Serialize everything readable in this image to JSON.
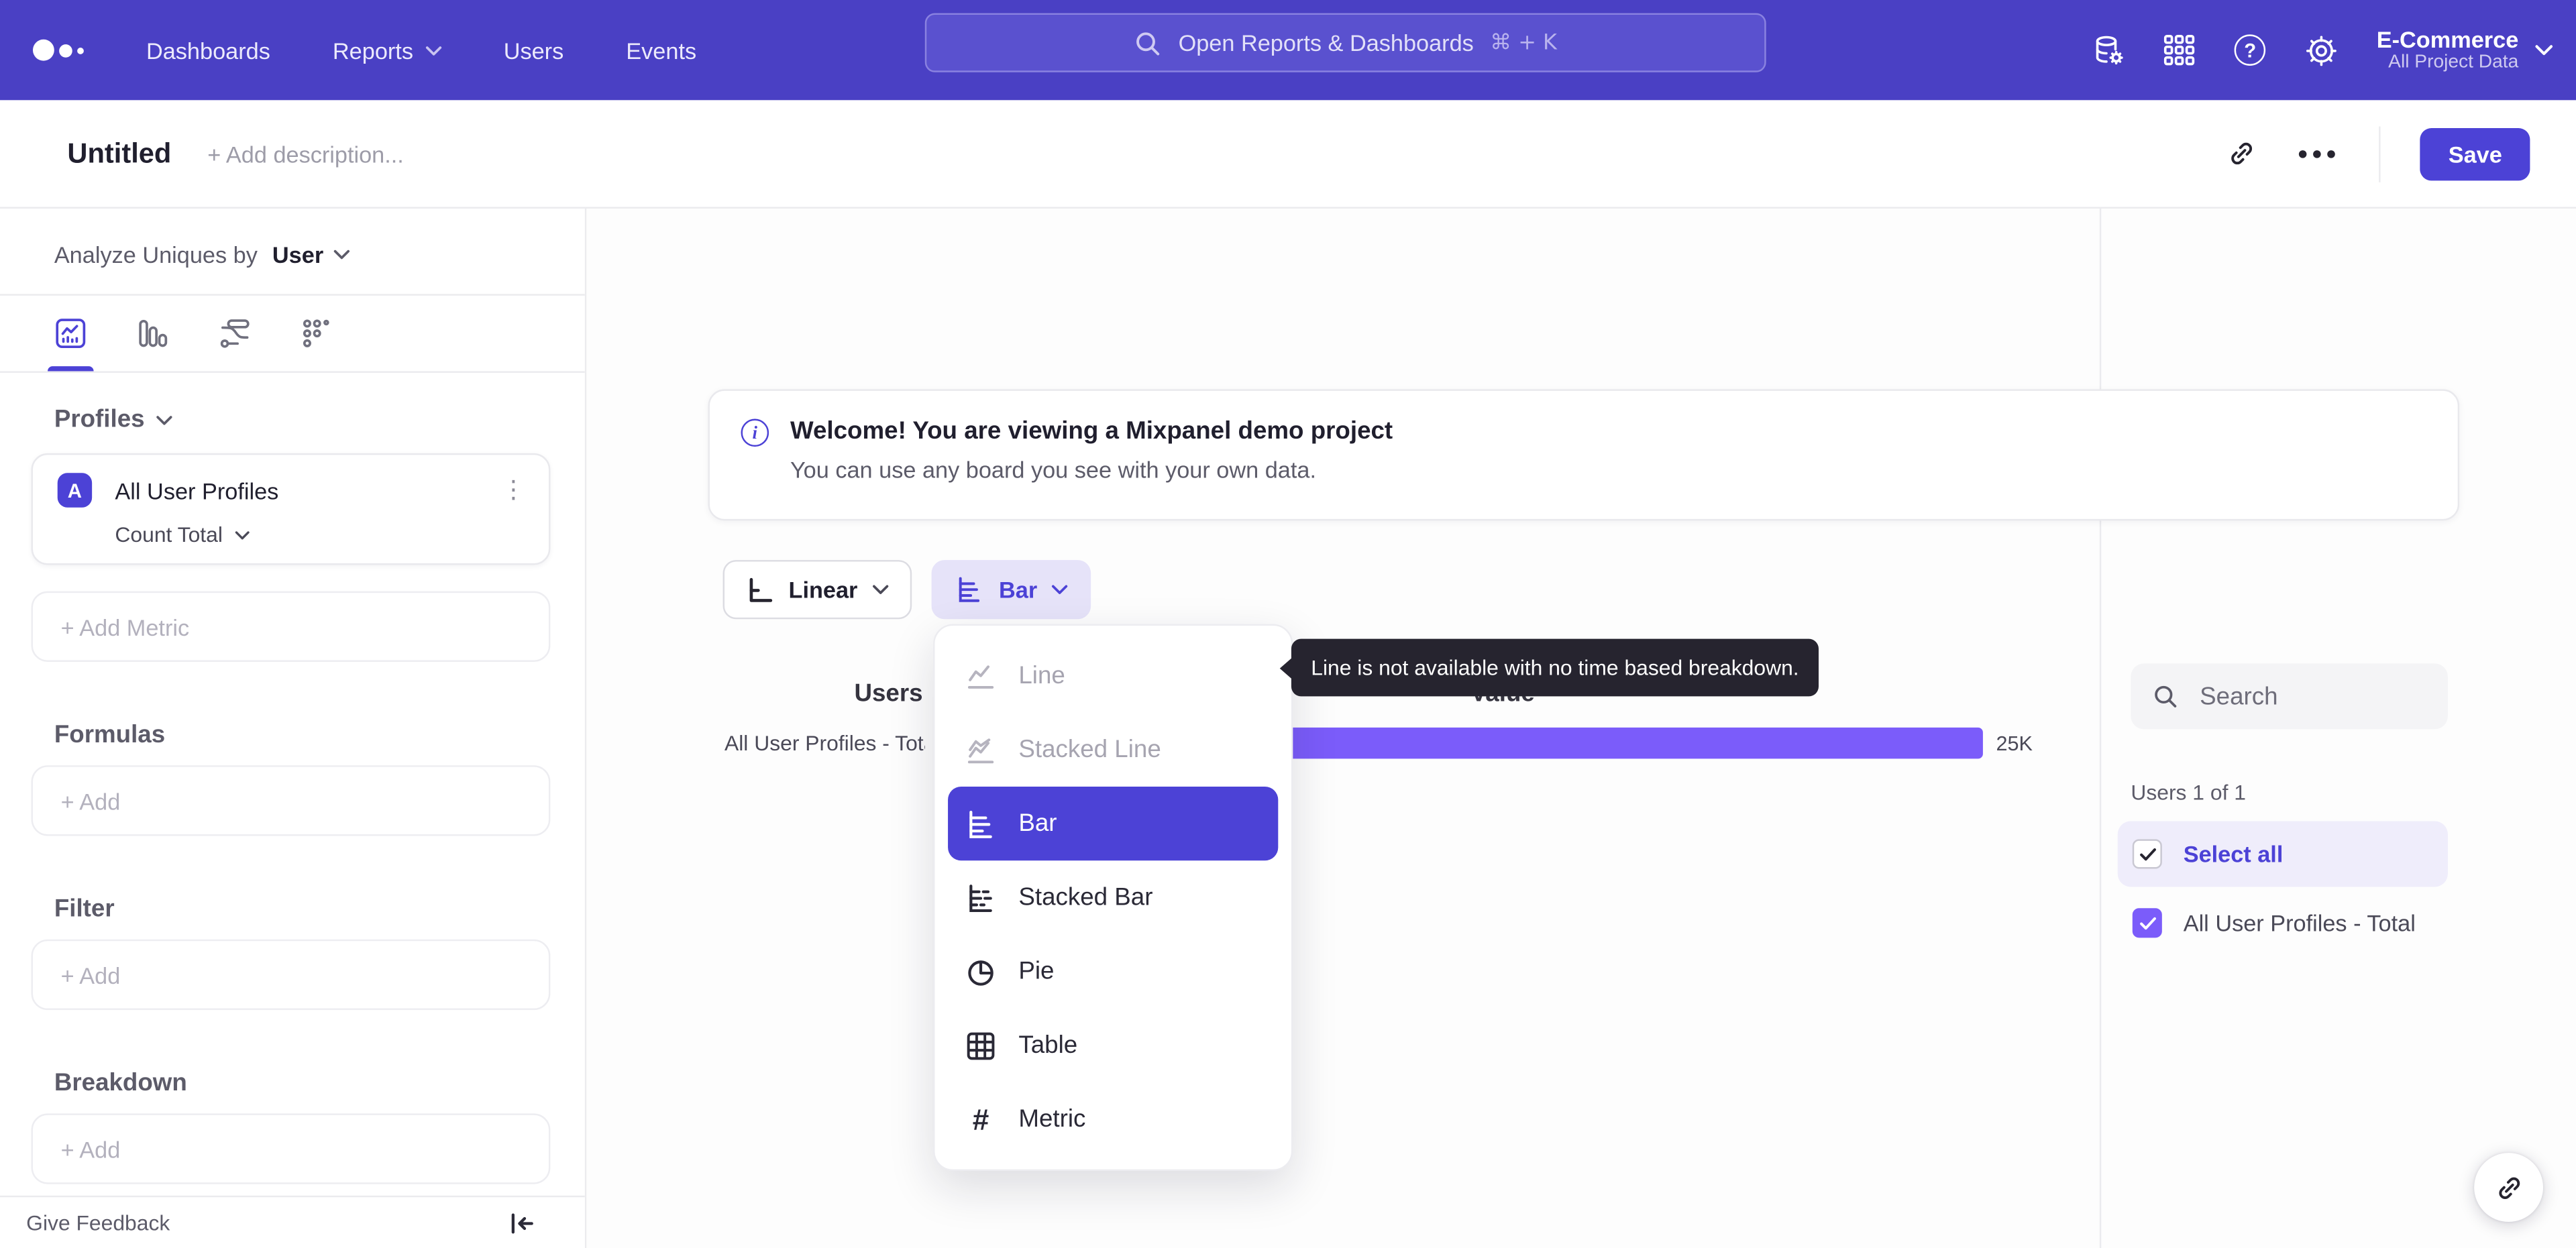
{
  "topnav": {
    "logo": "mixpanel",
    "items": [
      "Dashboards",
      "Reports",
      "Users",
      "Events"
    ],
    "search": {
      "placeholder": "Open Reports & Dashboards",
      "shortcut": "⌘ + K"
    },
    "project": {
      "name": "E-Commerce",
      "scope": "All Project Data"
    }
  },
  "titlebar": {
    "title": "Untitled",
    "description_placeholder": "+ Add description...",
    "save_label": "Save"
  },
  "sidebar": {
    "analyze_prefix": "Analyze Uniques by",
    "analyze_value": "User",
    "profiles_heading": "Profiles",
    "metric_card": {
      "badge": "A",
      "name": "All User Profiles",
      "aggregation": "Count Total"
    },
    "add_metric_label": "+ Add Metric",
    "formulas_heading": "Formulas",
    "formulas_add": "+ Add",
    "filter_heading": "Filter",
    "filter_add": "+ Add",
    "breakdown_heading": "Breakdown",
    "breakdown_add": "+ Add",
    "give_feedback": "Give Feedback"
  },
  "banner": {
    "title": "Welcome! You are viewing a Mixpanel demo project",
    "subtitle": "You can use any board you see with your own data."
  },
  "controls": {
    "scale_label": "Linear",
    "chart_type_label": "Bar"
  },
  "chart_menu": {
    "items": [
      {
        "label": "Line",
        "state": "disabled"
      },
      {
        "label": "Stacked Line",
        "state": "disabled"
      },
      {
        "label": "Bar",
        "state": "selected"
      },
      {
        "label": "Stacked Bar",
        "state": "normal"
      },
      {
        "label": "Pie",
        "state": "normal"
      },
      {
        "label": "Table",
        "state": "normal"
      },
      {
        "label": "Metric",
        "state": "normal"
      }
    ]
  },
  "tooltip": {
    "text": "Line is not available with no time based breakdown."
  },
  "chart": {
    "group_header": "Users",
    "value_header": "Value",
    "row_label": "All User Profiles - Total",
    "row_value": "25K"
  },
  "chart_data": {
    "type": "bar",
    "orientation": "horizontal",
    "title": "Users",
    "xlabel": "Value",
    "categories": [
      "All User Profiles - Total"
    ],
    "values": [
      25000
    ],
    "value_labels": [
      "25K"
    ],
    "series_color": "#7b5cfa"
  },
  "legend": {
    "search_placeholder": "Search",
    "count_label": "Users 1 of 1",
    "select_all_label": "Select all",
    "items": [
      {
        "label": "All User Profiles - Total",
        "checked": true
      }
    ]
  },
  "colors": {
    "nav": "#4a40c4",
    "accent": "#4c42d6",
    "bar": "#7b5cfa",
    "tooltip_bg": "#26242f"
  }
}
